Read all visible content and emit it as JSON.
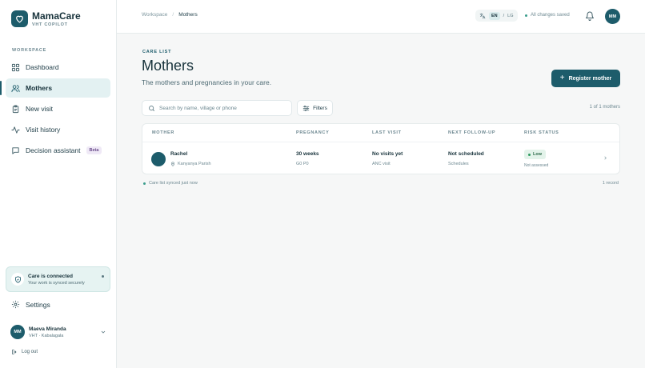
{
  "brand": {
    "name": "MamaCare",
    "subtitle": "VHT COPILOT"
  },
  "sidebar": {
    "section_label": "WORKSPACE",
    "items": [
      {
        "label": "Dashboard",
        "icon": "dashboard-icon",
        "active": false
      },
      {
        "label": "Mothers",
        "icon": "users-icon",
        "active": true
      },
      {
        "label": "New visit",
        "icon": "clipboard-icon",
        "active": false
      },
      {
        "label": "Visit history",
        "icon": "activity-icon",
        "active": false
      },
      {
        "label": "Decision assistant",
        "icon": "chat-icon",
        "active": false,
        "badge": "Beta"
      }
    ],
    "care_card": {
      "title": "Care is connected",
      "subtitle": "Your work is synced securely"
    },
    "settings_label": "Settings",
    "user": {
      "initials": "MM",
      "name": "Maeva Miranda",
      "role": "VHT · Kabalagala"
    },
    "logout_label": "Log out"
  },
  "topbar": {
    "breadcrumb": {
      "root": "Workspace",
      "separator": "/",
      "current": "Mothers"
    },
    "language": {
      "active": "EN",
      "separator": "/",
      "other": "LG"
    },
    "save_status": "All changes saved",
    "avatar_initials": "MM"
  },
  "main": {
    "eyebrow": "CARE LIST",
    "title": "Mothers",
    "subtitle": "The mothers and pregnancies in your care.",
    "register_button": "Register mother",
    "search_placeholder": "Search by name, village or phone",
    "filters_label": "Filters",
    "count_text": "1 of 1 mothers",
    "table": {
      "columns": [
        "MOTHER",
        "PREGNANCY",
        "LAST VISIT",
        "NEXT FOLLOW-UP",
        "RISK STATUS"
      ],
      "rows": [
        {
          "name": "Rachel",
          "location": "Kanyanya Parish",
          "pregnancy": "30 weeks",
          "pregnancy_sub": "G0 P0",
          "last_visit": "No visits yet",
          "last_visit_sub": "ANC visit",
          "next_follow_up": "Not scheduled",
          "next_follow_up_sub": "Schedules",
          "risk": "Low",
          "risk_sub": "Not assessed"
        }
      ]
    },
    "footer_sync": "Care list synced just now",
    "footer_records": "1 record"
  },
  "colors": {
    "brand": "#1d5c6b",
    "active_bg": "#e3f1f2",
    "risk_low_bg": "#e3f3ea",
    "risk_low_dot": "#2e9a5f"
  }
}
